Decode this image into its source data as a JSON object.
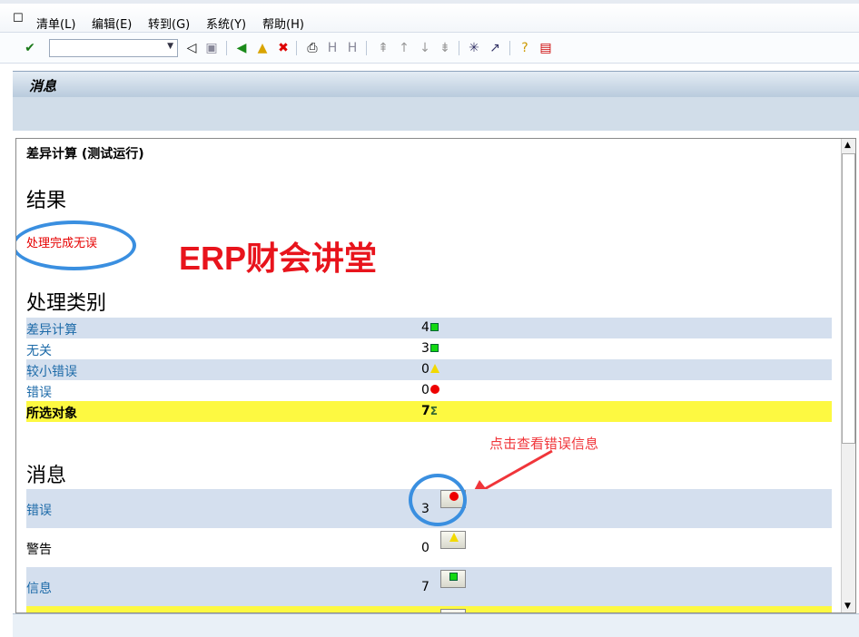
{
  "menu": [
    "清单(L)",
    "编辑(E)",
    "转到(G)",
    "系统(Y)",
    "帮助(H)"
  ],
  "title": "消息",
  "content": {
    "heading": "差异计算 (测试运行)",
    "result_title": "结果",
    "result_text": "处理完成无误",
    "watermark": "ERP财会讲堂",
    "categories_title": "处理类别",
    "categories": [
      {
        "label": "差异计算",
        "value": "4",
        "icon": "green-square"
      },
      {
        "label": "无关",
        "value": "3",
        "icon": "green-square"
      },
      {
        "label": "较小错误",
        "value": "0",
        "icon": "yellow-triangle"
      },
      {
        "label": "错误",
        "value": "0",
        "icon": "red-circle"
      },
      {
        "label": "所选对象",
        "value": "7",
        "icon": "sigma"
      }
    ],
    "annotation": "点击查看错误信息",
    "messages_title": "消息",
    "messages": [
      {
        "label": "错误",
        "value": "3",
        "icon": "red-circle"
      },
      {
        "label": "警告",
        "value": "0",
        "icon": "yellow-triangle"
      },
      {
        "label": "信息",
        "value": "7",
        "icon": "green-square"
      }
    ]
  }
}
